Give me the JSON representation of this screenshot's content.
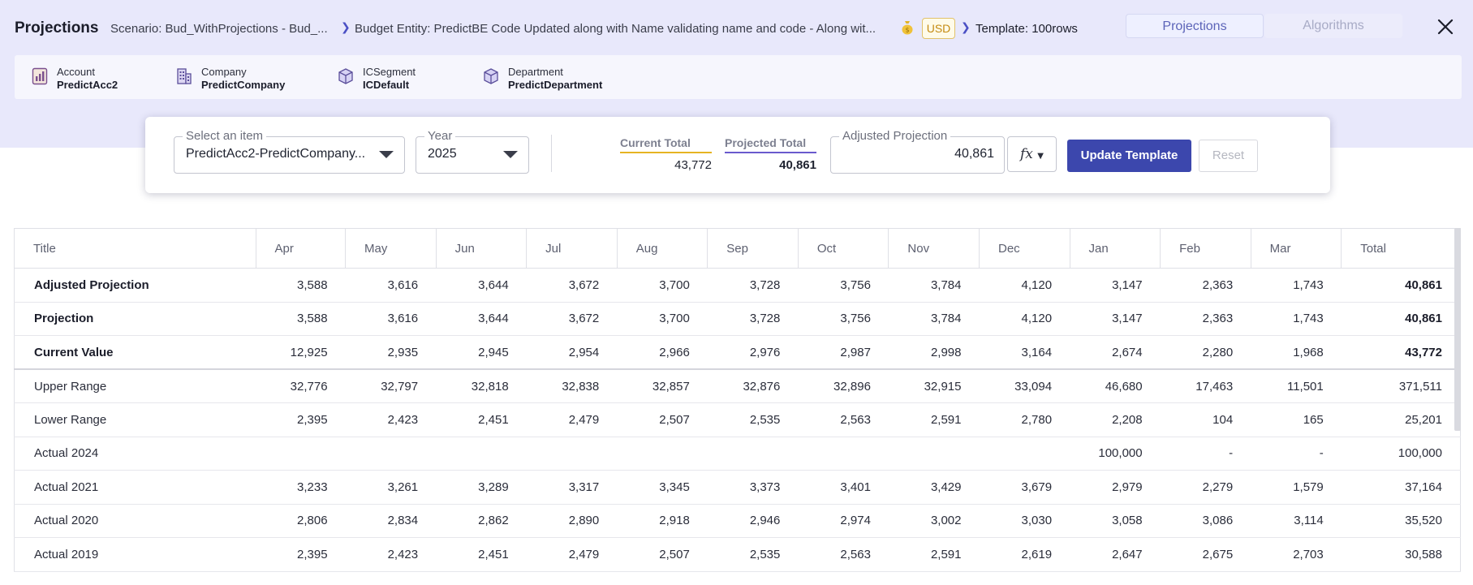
{
  "header": {
    "title": "Projections",
    "scenario": "Scenario: Bud_WithProjections - Bud_...",
    "entity": "Budget Entity: PredictBE Code Updated along with Name validating name and code - Along wit...",
    "currency": "USD",
    "template": "Template: 100rows",
    "tabs": [
      {
        "label": "Projections",
        "active": true
      },
      {
        "label": "Algorithms",
        "active": false
      }
    ],
    "close_icon": "close-icon"
  },
  "dimensions": [
    {
      "label": "Account",
      "value": "PredictAcc2",
      "icon": "account-icon"
    },
    {
      "label": "Company",
      "value": "PredictCompany",
      "icon": "building-icon"
    },
    {
      "label": "ICSegment",
      "value": "ICDefault",
      "icon": "cube-icon"
    },
    {
      "label": "Department",
      "value": "PredictDepartment",
      "icon": "cube-icon"
    }
  ],
  "controls": {
    "item": {
      "legend": "Select an item",
      "value": "PredictAcc2-PredictCompany..."
    },
    "year": {
      "legend": "Year",
      "value": "2025"
    },
    "current_total": {
      "label": "Current Total",
      "value": "43,772",
      "color": "#e6b422"
    },
    "projected_total": {
      "label": "Projected Total",
      "value": "40,861",
      "color": "#6a5acd"
    },
    "adjusted": {
      "legend": "Adjusted Projection",
      "value": "40,861"
    },
    "fx_label": "fx",
    "update_label": "Update Template",
    "reset_label": "Reset"
  },
  "table": {
    "columns": [
      "Title",
      "Apr",
      "May",
      "Jun",
      "Jul",
      "Aug",
      "Sep",
      "Oct",
      "Nov",
      "Dec",
      "Jan",
      "Feb",
      "Mar",
      "Total"
    ],
    "rows": [
      {
        "title": "Adjusted Projection",
        "bold": true,
        "values": [
          "3,588",
          "3,616",
          "3,644",
          "3,672",
          "3,700",
          "3,728",
          "3,756",
          "3,784",
          "4,120",
          "3,147",
          "2,363",
          "1,743"
        ],
        "total": "40,861"
      },
      {
        "title": "Projection",
        "bold": true,
        "values": [
          "3,588",
          "3,616",
          "3,644",
          "3,672",
          "3,700",
          "3,728",
          "3,756",
          "3,784",
          "4,120",
          "3,147",
          "2,363",
          "1,743"
        ],
        "total": "40,861"
      },
      {
        "title": "Current Value",
        "bold": true,
        "values": [
          "12,925",
          "2,935",
          "2,945",
          "2,954",
          "2,966",
          "2,976",
          "2,987",
          "2,998",
          "3,164",
          "2,674",
          "2,280",
          "1,968"
        ],
        "total": "43,772"
      },
      {
        "title": "Upper Range",
        "bold": false,
        "values": [
          "32,776",
          "32,797",
          "32,818",
          "32,838",
          "32,857",
          "32,876",
          "32,896",
          "32,915",
          "33,094",
          "46,680",
          "17,463",
          "11,501"
        ],
        "total": "371,511"
      },
      {
        "title": "Lower Range",
        "bold": false,
        "values": [
          "2,395",
          "2,423",
          "2,451",
          "2,479",
          "2,507",
          "2,535",
          "2,563",
          "2,591",
          "2,780",
          "2,208",
          "104",
          "165"
        ],
        "total": "25,201"
      },
      {
        "title": "Actual 2024",
        "bold": false,
        "values": [
          "",
          "",
          "",
          "",
          "",
          "",
          "",
          "",
          "",
          "100,000",
          "-",
          "-"
        ],
        "total": "100,000"
      },
      {
        "title": "Actual 2021",
        "bold": false,
        "values": [
          "3,233",
          "3,261",
          "3,289",
          "3,317",
          "3,345",
          "3,373",
          "3,401",
          "3,429",
          "3,679",
          "2,979",
          "2,279",
          "1,579"
        ],
        "total": "37,164"
      },
      {
        "title": "Actual 2020",
        "bold": false,
        "values": [
          "2,806",
          "2,834",
          "2,862",
          "2,890",
          "2,918",
          "2,946",
          "2,974",
          "3,002",
          "3,030",
          "3,058",
          "3,086",
          "3,114"
        ],
        "total": "35,520"
      },
      {
        "title": "Actual 2019",
        "bold": false,
        "values": [
          "2,395",
          "2,423",
          "2,451",
          "2,479",
          "2,507",
          "2,535",
          "2,563",
          "2,591",
          "2,619",
          "2,647",
          "2,675",
          "2,703"
        ],
        "total": "30,588"
      }
    ]
  }
}
